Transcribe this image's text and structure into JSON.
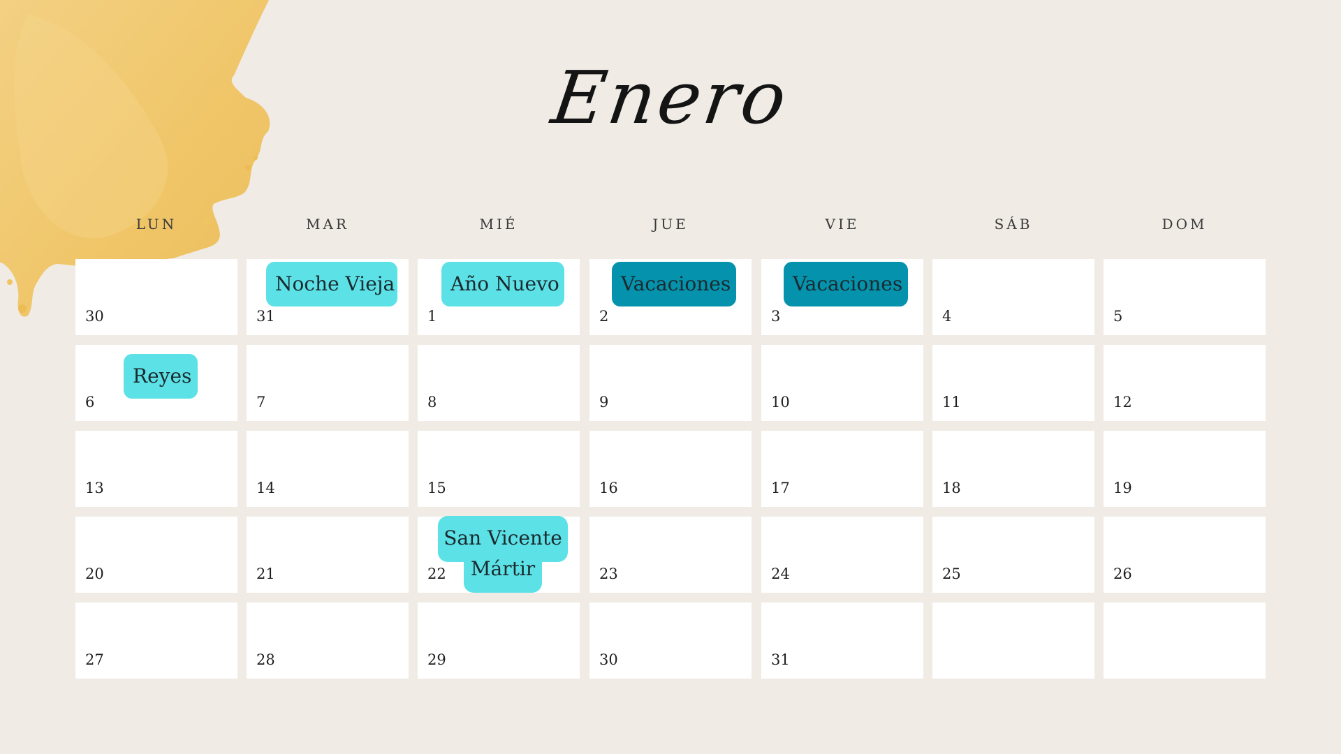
{
  "calendar": {
    "month": "Enero",
    "weekdays": [
      "LUN",
      "MAR",
      "MIÉ",
      "JUE",
      "VIE",
      "SÁB",
      "DOM"
    ],
    "weeks": [
      [
        "30",
        "31",
        "1",
        "2",
        "3",
        "4",
        "5"
      ],
      [
        "6",
        "7",
        "8",
        "9",
        "10",
        "11",
        "12"
      ],
      [
        "13",
        "14",
        "15",
        "16",
        "17",
        "18",
        "19"
      ],
      [
        "20",
        "21",
        "22",
        "23",
        "24",
        "25",
        "26"
      ],
      [
        "27",
        "28",
        "29",
        "30",
        "31",
        "",
        ""
      ]
    ],
    "events": {
      "noche_vieja": "Noche Vieja",
      "ano_nuevo": "Año Nuevo",
      "vacaciones_jue": "Vacaciones",
      "vacaciones_vie": "Vacaciones",
      "reyes": "Reyes",
      "san_vicente_line1": "San Vicente",
      "san_vicente_line2": "Mártir"
    }
  },
  "colors": {
    "background": "#f0ebe5",
    "cell": "#ffffff",
    "event_light": "#5ce1e6",
    "event_dark": "#0592ad",
    "watercolor": "#f0c868"
  }
}
